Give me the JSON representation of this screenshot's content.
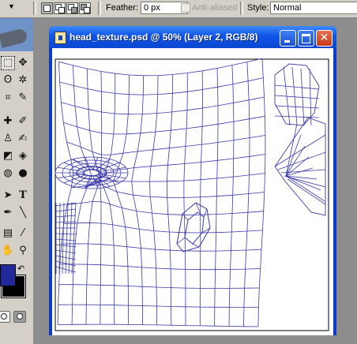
{
  "options_bar": {
    "feather_label": "Feather:",
    "feather_value": "0 px",
    "anti_aliased_label": "Anti-aliased",
    "anti_aliased_checked": false,
    "style_label": "Style:",
    "style_value": "Normal"
  },
  "toolbox": {
    "tools": [
      "marquee",
      "move",
      "lasso",
      "magic-wand",
      "crop",
      "slice",
      "healing-brush",
      "brush",
      "clone-stamp",
      "history-brush",
      "eraser",
      "paint-bucket",
      "blur",
      "dodge",
      "path-selection",
      "type",
      "pen",
      "line",
      "notes",
      "eyedropper",
      "hand",
      "zoom"
    ],
    "type_tool_glyph": "T",
    "foreground_color": "#23289a",
    "background_color": "#000000"
  },
  "document": {
    "title": "head_texture.psd @ 50% (Layer 2, RGB/8)",
    "zoom": "50%",
    "layer": "Layer 2",
    "mode": "RGB/8",
    "wire_color": "#3a3aa8"
  }
}
